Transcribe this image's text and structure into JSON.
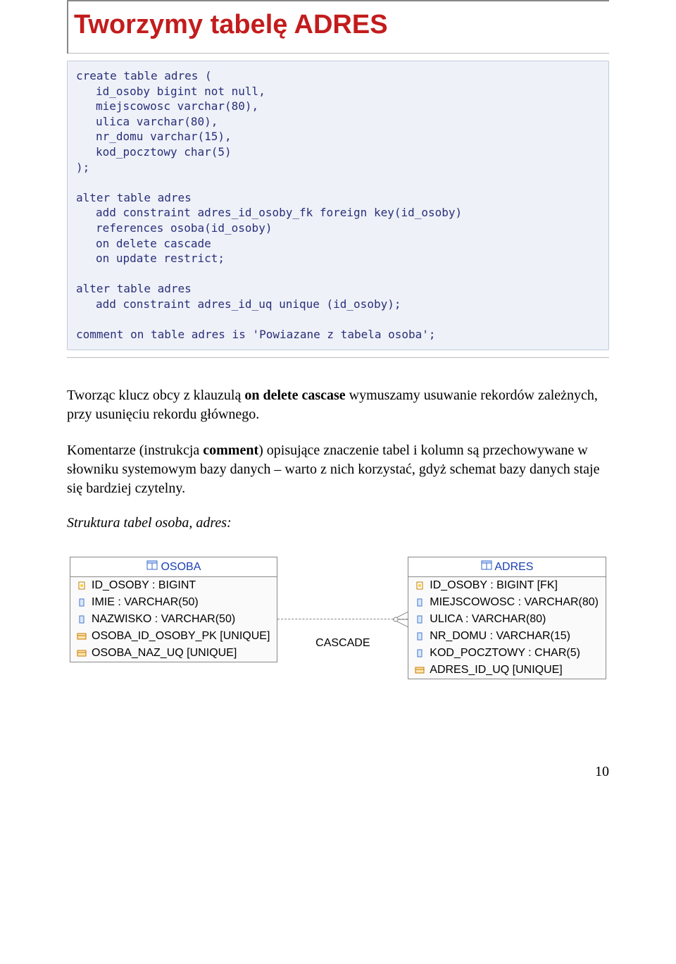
{
  "title": "Tworzymy tabelę ADRES",
  "code": {
    "l1": "create table adres (",
    "l2": "id_osoby bigint not null,",
    "l3": "miejscowosc varchar(80),",
    "l4": "ulica varchar(80),",
    "l5": "nr_domu varchar(15),",
    "l6": "kod_pocztowy char(5)",
    "l7": ");",
    "l8": "alter table adres",
    "l9": "add constraint adres_id_osoby_fk foreign key(id_osoby)",
    "l10": "references osoba(id_osoby)",
    "l11": "on delete cascade",
    "l12": "on update restrict;",
    "l13": "alter table adres",
    "l14": "add constraint adres_id_uq unique (id_osoby);",
    "l15": "comment on table adres is 'Powiazane z tabela osoba';"
  },
  "paragraph1": {
    "part1": "Tworząc klucz obcy z klauzulą ",
    "bold1": "on delete cascase",
    "part2": " wymuszamy usuwanie rekordów zależnych, przy usunięciu rekordu głównego."
  },
  "paragraph2": {
    "part1": "Komentarze (instrukcja ",
    "bold1": "comment",
    "part2": ") opisujące znaczenie tabel i kolumn są przechowywane w słowniku systemowym bazy danych – warto z nich korzystać, gdyż schemat bazy danych staje się bardziej czytelny."
  },
  "subheading": "Struktura tabel osoba, adres:",
  "tables": {
    "osoba": {
      "name": "OSOBA",
      "rows": [
        {
          "icon": "pk",
          "text": "ID_OSOBY : BIGINT"
        },
        {
          "icon": "col",
          "text": "IMIE : VARCHAR(50)"
        },
        {
          "icon": "col",
          "text": "NAZWISKO : VARCHAR(50)"
        },
        {
          "icon": "idx",
          "text": "OSOBA_ID_OSOBY_PK [UNIQUE]"
        },
        {
          "icon": "idx",
          "text": "OSOBA_NAZ_UQ [UNIQUE]"
        }
      ]
    },
    "adres": {
      "name": "ADRES",
      "rows": [
        {
          "icon": "pk",
          "text": "ID_OSOBY : BIGINT [FK]"
        },
        {
          "icon": "col",
          "text": "MIEJSCOWOSC : VARCHAR(80)"
        },
        {
          "icon": "col",
          "text": "ULICA : VARCHAR(80)"
        },
        {
          "icon": "col",
          "text": "NR_DOMU : VARCHAR(15)"
        },
        {
          "icon": "col",
          "text": "KOD_POCZTOWY : CHAR(5)"
        },
        {
          "icon": "idx",
          "text": "ADRES_ID_UQ [UNIQUE]"
        }
      ]
    },
    "connector_label": "CASCADE"
  },
  "page_number": "10"
}
